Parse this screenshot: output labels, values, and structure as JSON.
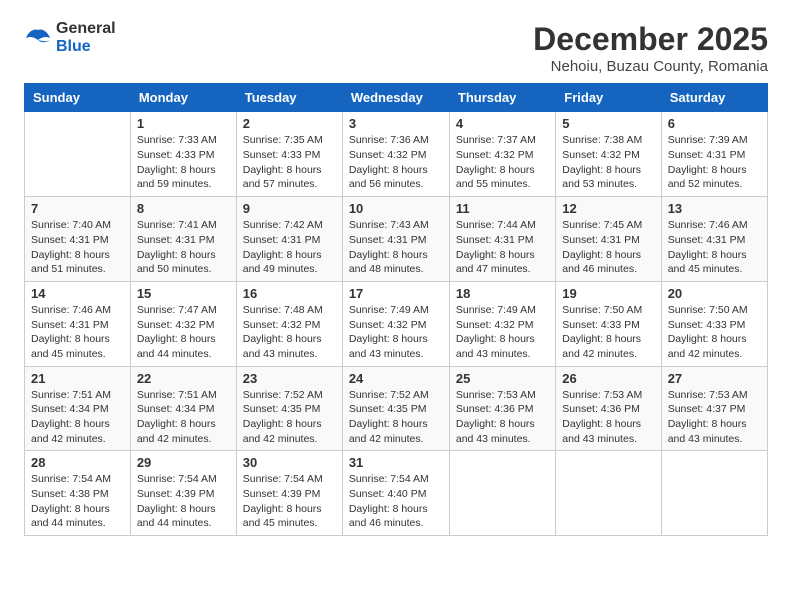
{
  "logo": {
    "general": "General",
    "blue": "Blue"
  },
  "header": {
    "month_year": "December 2025",
    "location": "Nehoiu, Buzau County, Romania"
  },
  "days_of_week": [
    "Sunday",
    "Monday",
    "Tuesday",
    "Wednesday",
    "Thursday",
    "Friday",
    "Saturday"
  ],
  "weeks": [
    [
      {
        "day": "",
        "sunrise": "",
        "sunset": "",
        "daylight": ""
      },
      {
        "day": "1",
        "sunrise": "Sunrise: 7:33 AM",
        "sunset": "Sunset: 4:33 PM",
        "daylight": "Daylight: 8 hours and 59 minutes."
      },
      {
        "day": "2",
        "sunrise": "Sunrise: 7:35 AM",
        "sunset": "Sunset: 4:33 PM",
        "daylight": "Daylight: 8 hours and 57 minutes."
      },
      {
        "day": "3",
        "sunrise": "Sunrise: 7:36 AM",
        "sunset": "Sunset: 4:32 PM",
        "daylight": "Daylight: 8 hours and 56 minutes."
      },
      {
        "day": "4",
        "sunrise": "Sunrise: 7:37 AM",
        "sunset": "Sunset: 4:32 PM",
        "daylight": "Daylight: 8 hours and 55 minutes."
      },
      {
        "day": "5",
        "sunrise": "Sunrise: 7:38 AM",
        "sunset": "Sunset: 4:32 PM",
        "daylight": "Daylight: 8 hours and 53 minutes."
      },
      {
        "day": "6",
        "sunrise": "Sunrise: 7:39 AM",
        "sunset": "Sunset: 4:31 PM",
        "daylight": "Daylight: 8 hours and 52 minutes."
      }
    ],
    [
      {
        "day": "7",
        "sunrise": "Sunrise: 7:40 AM",
        "sunset": "Sunset: 4:31 PM",
        "daylight": "Daylight: 8 hours and 51 minutes."
      },
      {
        "day": "8",
        "sunrise": "Sunrise: 7:41 AM",
        "sunset": "Sunset: 4:31 PM",
        "daylight": "Daylight: 8 hours and 50 minutes."
      },
      {
        "day": "9",
        "sunrise": "Sunrise: 7:42 AM",
        "sunset": "Sunset: 4:31 PM",
        "daylight": "Daylight: 8 hours and 49 minutes."
      },
      {
        "day": "10",
        "sunrise": "Sunrise: 7:43 AM",
        "sunset": "Sunset: 4:31 PM",
        "daylight": "Daylight: 8 hours and 48 minutes."
      },
      {
        "day": "11",
        "sunrise": "Sunrise: 7:44 AM",
        "sunset": "Sunset: 4:31 PM",
        "daylight": "Daylight: 8 hours and 47 minutes."
      },
      {
        "day": "12",
        "sunrise": "Sunrise: 7:45 AM",
        "sunset": "Sunset: 4:31 PM",
        "daylight": "Daylight: 8 hours and 46 minutes."
      },
      {
        "day": "13",
        "sunrise": "Sunrise: 7:46 AM",
        "sunset": "Sunset: 4:31 PM",
        "daylight": "Daylight: 8 hours and 45 minutes."
      }
    ],
    [
      {
        "day": "14",
        "sunrise": "Sunrise: 7:46 AM",
        "sunset": "Sunset: 4:31 PM",
        "daylight": "Daylight: 8 hours and 45 minutes."
      },
      {
        "day": "15",
        "sunrise": "Sunrise: 7:47 AM",
        "sunset": "Sunset: 4:32 PM",
        "daylight": "Daylight: 8 hours and 44 minutes."
      },
      {
        "day": "16",
        "sunrise": "Sunrise: 7:48 AM",
        "sunset": "Sunset: 4:32 PM",
        "daylight": "Daylight: 8 hours and 43 minutes."
      },
      {
        "day": "17",
        "sunrise": "Sunrise: 7:49 AM",
        "sunset": "Sunset: 4:32 PM",
        "daylight": "Daylight: 8 hours and 43 minutes."
      },
      {
        "day": "18",
        "sunrise": "Sunrise: 7:49 AM",
        "sunset": "Sunset: 4:32 PM",
        "daylight": "Daylight: 8 hours and 43 minutes."
      },
      {
        "day": "19",
        "sunrise": "Sunrise: 7:50 AM",
        "sunset": "Sunset: 4:33 PM",
        "daylight": "Daylight: 8 hours and 42 minutes."
      },
      {
        "day": "20",
        "sunrise": "Sunrise: 7:50 AM",
        "sunset": "Sunset: 4:33 PM",
        "daylight": "Daylight: 8 hours and 42 minutes."
      }
    ],
    [
      {
        "day": "21",
        "sunrise": "Sunrise: 7:51 AM",
        "sunset": "Sunset: 4:34 PM",
        "daylight": "Daylight: 8 hours and 42 minutes."
      },
      {
        "day": "22",
        "sunrise": "Sunrise: 7:51 AM",
        "sunset": "Sunset: 4:34 PM",
        "daylight": "Daylight: 8 hours and 42 minutes."
      },
      {
        "day": "23",
        "sunrise": "Sunrise: 7:52 AM",
        "sunset": "Sunset: 4:35 PM",
        "daylight": "Daylight: 8 hours and 42 minutes."
      },
      {
        "day": "24",
        "sunrise": "Sunrise: 7:52 AM",
        "sunset": "Sunset: 4:35 PM",
        "daylight": "Daylight: 8 hours and 42 minutes."
      },
      {
        "day": "25",
        "sunrise": "Sunrise: 7:53 AM",
        "sunset": "Sunset: 4:36 PM",
        "daylight": "Daylight: 8 hours and 43 minutes."
      },
      {
        "day": "26",
        "sunrise": "Sunrise: 7:53 AM",
        "sunset": "Sunset: 4:36 PM",
        "daylight": "Daylight: 8 hours and 43 minutes."
      },
      {
        "day": "27",
        "sunrise": "Sunrise: 7:53 AM",
        "sunset": "Sunset: 4:37 PM",
        "daylight": "Daylight: 8 hours and 43 minutes."
      }
    ],
    [
      {
        "day": "28",
        "sunrise": "Sunrise: 7:54 AM",
        "sunset": "Sunset: 4:38 PM",
        "daylight": "Daylight: 8 hours and 44 minutes."
      },
      {
        "day": "29",
        "sunrise": "Sunrise: 7:54 AM",
        "sunset": "Sunset: 4:39 PM",
        "daylight": "Daylight: 8 hours and 44 minutes."
      },
      {
        "day": "30",
        "sunrise": "Sunrise: 7:54 AM",
        "sunset": "Sunset: 4:39 PM",
        "daylight": "Daylight: 8 hours and 45 minutes."
      },
      {
        "day": "31",
        "sunrise": "Sunrise: 7:54 AM",
        "sunset": "Sunset: 4:40 PM",
        "daylight": "Daylight: 8 hours and 46 minutes."
      },
      {
        "day": "",
        "sunrise": "",
        "sunset": "",
        "daylight": ""
      },
      {
        "day": "",
        "sunrise": "",
        "sunset": "",
        "daylight": ""
      },
      {
        "day": "",
        "sunrise": "",
        "sunset": "",
        "daylight": ""
      }
    ]
  ]
}
